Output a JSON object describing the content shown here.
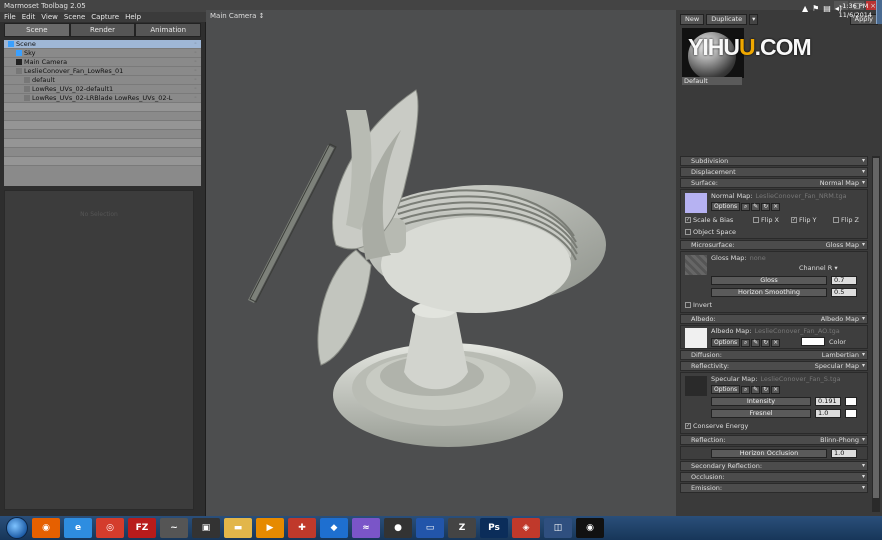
{
  "window": {
    "title": "Marmoset Toolbag 2.05",
    "controls": [
      "–",
      "□",
      "×"
    ]
  },
  "menu": [
    "File",
    "Edit",
    "View",
    "Scene",
    "Capture",
    "Help"
  ],
  "left_panel": {
    "tabs": [
      "Scene",
      "Render",
      "Animation"
    ],
    "tree": [
      {
        "label": "Scene",
        "indent": 0,
        "icon_color": "#3aa0ff",
        "selected": true
      },
      {
        "label": "Sky",
        "indent": 1,
        "icon_color": "#3aa0ff"
      },
      {
        "label": "Main Camera",
        "indent": 1,
        "icon_color": "#222222"
      },
      {
        "label": "LeslieConover_Fan_LowRes_01",
        "indent": 1,
        "icon_color": "#777777"
      },
      {
        "label": "default",
        "indent": 2,
        "icon_color": "#777777"
      },
      {
        "label": "LowRes_UVs_02-default1",
        "indent": 2,
        "icon_color": "#777777"
      },
      {
        "label": "LowRes_UVs_02-LRBlade LowRes_UVs_02-L",
        "indent": 2,
        "icon_color": "#777777"
      }
    ],
    "properties_empty_text": "No Selection"
  },
  "viewport": {
    "title": "Main Camera ↕"
  },
  "right_panel": {
    "toolbar": {
      "new": "New",
      "duplicate": "Duplicate",
      "selector": "▾",
      "apply": "Apply"
    },
    "watermark": {
      "pre": "YI",
      "mid": "HU",
      "u": "U",
      "post": ".COM"
    },
    "material_name": "Default",
    "sections": {
      "subdivision": "Subdivision",
      "displacement": "Displacement",
      "surface": {
        "title": "Surface:",
        "value": "Normal Map"
      },
      "normal_map": {
        "label": "Normal Map:",
        "file": "LeslieConover_Fan_NRM.tga",
        "options": "Options",
        "scale_bias": "Scale & Bias",
        "flip_x": "Flip X",
        "flip_y": "Flip Y",
        "flip_z": "Flip Z",
        "object_space": "Object Space"
      },
      "microsurface": {
        "title": "Microsurface:",
        "value": "Gloss Map"
      },
      "gloss_map": {
        "label": "Gloss Map:",
        "file": "none",
        "channel_label": "Channel",
        "channel": "R",
        "gloss_label": "Gloss",
        "gloss_value": "0.7",
        "horizon_label": "Horizon Smoothing",
        "horizon_value": "0.5",
        "invert": "Invert"
      },
      "albedo": {
        "title": "Albedo:",
        "value": "Albedo Map"
      },
      "albedo_map": {
        "label": "Albedo Map:",
        "file": "LeslieConover_Fan_AO.tga",
        "options": "Options",
        "color": "Color"
      },
      "diffusion": {
        "title": "Diffusion:",
        "value": "Lambertian"
      },
      "reflectivity": {
        "title": "Reflectivity:",
        "value": "Specular Map"
      },
      "specular_map": {
        "label": "Specular Map:",
        "file": "LeslieConover_Fan_S.tga",
        "options": "Options",
        "intensity_label": "Intensity",
        "intensity_value": "0.191",
        "fresnel_label": "Fresnel",
        "fresnel_value": "1.0",
        "conserve": "Conserve Energy"
      },
      "reflection": {
        "title": "Reflection:",
        "value": "Blinn-Phong"
      },
      "horizon_occlusion_label": "Horizon Occlusion",
      "horizon_occlusion_value": "1.0",
      "secondary_reflection": "Secondary Reflection:",
      "occlusion": "Occlusion:",
      "emission": "Emission:"
    }
  },
  "taskbar": {
    "apps": [
      {
        "name": "firefox-icon",
        "color": "#e66000",
        "glyph": "◉"
      },
      {
        "name": "internet-explorer-icon",
        "color": "#2e8de0",
        "glyph": "e"
      },
      {
        "name": "chrome-icon",
        "color": "#d43c2c",
        "glyph": "◎"
      },
      {
        "name": "filezilla-icon",
        "color": "#b81b1b",
        "glyph": "FZ"
      },
      {
        "name": "app-icon",
        "color": "#555555",
        "glyph": "~"
      },
      {
        "name": "marmoset-icon",
        "color": "#333333",
        "glyph": "▣"
      },
      {
        "name": "folder-icon",
        "color": "#e2b64a",
        "glyph": "▬"
      },
      {
        "name": "media-player-icon",
        "color": "#e68a00",
        "glyph": "▶"
      },
      {
        "name": "app-red-icon",
        "color": "#c0392b",
        "glyph": "✚"
      },
      {
        "name": "dropbox-icon",
        "color": "#1e6fd0",
        "glyph": "◆"
      },
      {
        "name": "app-purple-icon",
        "color": "#7a55c8",
        "glyph": "≈"
      },
      {
        "name": "app-dark-icon",
        "color": "#333333",
        "glyph": "●"
      },
      {
        "name": "app-monitor-icon",
        "color": "#2255aa",
        "glyph": "▭"
      },
      {
        "name": "zbrush-icon",
        "color": "#444444",
        "glyph": "Z"
      },
      {
        "name": "photoshop-icon",
        "color": "#0b2d5a",
        "glyph": "Ps"
      },
      {
        "name": "app-cube-icon",
        "color": "#c0392b",
        "glyph": "◈"
      },
      {
        "name": "app-camera-icon",
        "color": "#2f4f7f",
        "glyph": "◫"
      },
      {
        "name": "app-eye-icon",
        "color": "#111111",
        "glyph": "◉"
      }
    ],
    "time": "1:36 PM",
    "date": "11/6/2014"
  }
}
